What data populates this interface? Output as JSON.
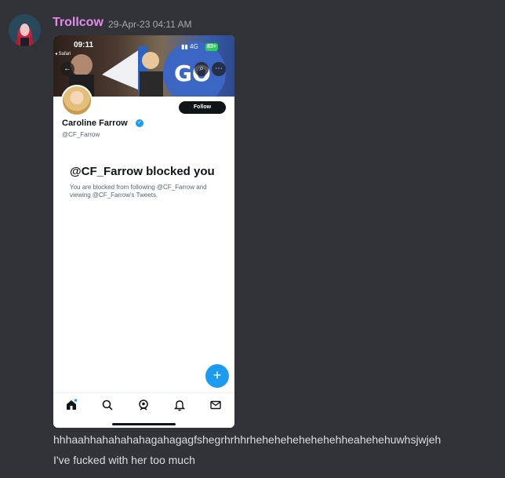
{
  "message": {
    "username": "Trollcow",
    "timestamp": "29-Apr-23 04:11 AM",
    "lines": [
      "hhhaahhahahahahagahagagfshegrhrhhrhehehehehehehehheahehehuwhsjwjeh",
      "I've fucked with her too much"
    ]
  },
  "screenshot": {
    "status_time": "09:11",
    "back_app": "◂ Safari",
    "signal": "4G",
    "battery": "83+",
    "profile": {
      "display_name": "Caroline Farrow",
      "handle": "@CF_Farrow",
      "follow_label": "Follow"
    },
    "blocked_title": "@CF_Farrow blocked you",
    "blocked_description": "You are blocked from following @CF_Farrow and viewing @CF_Farrow's Tweets.",
    "banner_text": "GO",
    "icons": {
      "back": "back-arrow-icon",
      "search": "search-icon",
      "more": "more-icon",
      "verified": "verified-badge-icon",
      "compose": "plus-icon",
      "tabs": [
        "home-icon",
        "search-icon",
        "spaces-icon",
        "bell-icon",
        "mail-icon"
      ]
    }
  },
  "colors": {
    "background": "#313338",
    "username": "#e58ae8",
    "twitter_blue": "#1d9bf0"
  }
}
